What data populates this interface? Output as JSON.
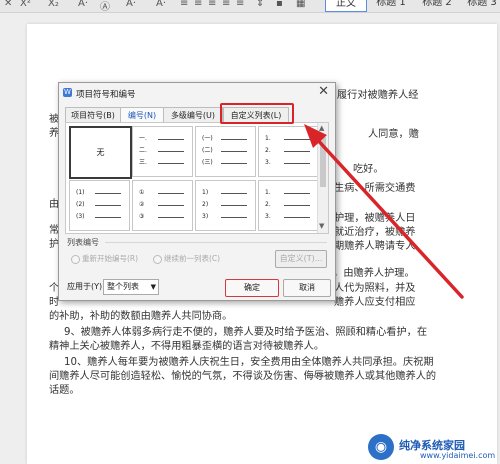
{
  "toolbar": {
    "icons": [
      "strikethrough-icon",
      "superscript-icon",
      "font-color-icon",
      "highlight-icon",
      "align-icons"
    ],
    "styles": [
      "正文",
      "标题 1",
      "标题 2",
      "标题 3"
    ]
  },
  "document": {
    "lines": [
      "9、被赡养人体弱多病行走不便的，赡养人要及时给予医治、照顾和精心看护，在",
      "精神上关心被赡养人，不得用粗暴歪横的语言对待被赡养人。",
      "10、赡养人每年要为被赡养人庆祝生日，安全费用由全体赡养人共同承担。庆祝期",
      "间赡养人尽可能创造轻松、愉悦的气氛，不得谈及伤害、侮辱被赡养人或其他赡养人的",
      "话题。"
    ],
    "right_fragments": {
      "r1": "履行对被赡养人经",
      "r2": "人同意，赡",
      "r3": "吃好。",
      "r4": "生病、所需交通费",
      "r5": "护理，被赡养人日",
      "r6": "就近治疗，被赡养",
      "r7": "期赡养人聘请专人",
      "r8": "次，由赡养人护理。",
      "r9": "人代为照料，并及",
      "r10": "赡养人应支付相应"
    },
    "left_fragments": {
      "l1": "被",
      "l2": "养",
      "l3": "由",
      "l4": "常",
      "l5": "护",
      "l6": "个",
      "l7": "时",
      "l8": "的补助，补助的数额由赡养人共同协商。"
    }
  },
  "dialog": {
    "title": "项目符号和编号",
    "tabs": [
      "项目符号(B)",
      "编号(N)",
      "多级编号(U)",
      "自定义列表(L)"
    ],
    "none_label": "无",
    "list_section_label": "列表编号",
    "radio_restart": "重新开始编号(R)",
    "radio_continue": "继续前一列表(C)",
    "customize_button": "自定义(T)...",
    "apply_label": "应用于(Y):",
    "apply_value": "整个列表",
    "ok_button": "确定",
    "cancel_button": "取消",
    "row1_styles": [
      [
        "一.",
        "二.",
        "三."
      ],
      [
        "(一)",
        "(二)",
        "(三)"
      ],
      [
        "1.",
        "2.",
        "3."
      ]
    ],
    "row2_styles": [
      [
        "(1)",
        "(2)",
        "(3)"
      ],
      [
        "①",
        "②",
        "③"
      ],
      [
        "1)",
        "2)",
        "3)"
      ],
      [
        "1.",
        "2.",
        "3."
      ]
    ]
  },
  "watermark": {
    "brand": "纯净系统家园",
    "url": "www.yidaimei.com"
  },
  "colors": {
    "highlight_red": "#d9242a",
    "accent_blue": "#1e5bb5"
  }
}
